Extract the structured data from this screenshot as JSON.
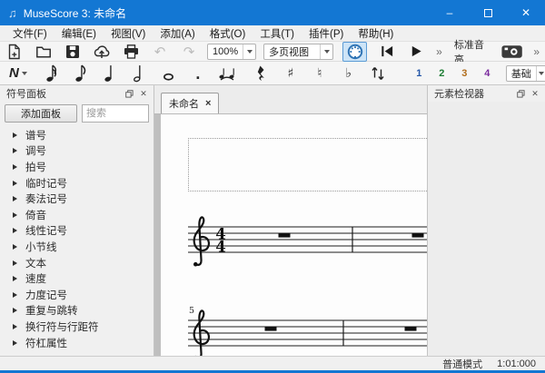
{
  "window": {
    "title": "MuseScore 3: 未命名",
    "controls": {
      "minimize": "–",
      "close": "✕"
    }
  },
  "menu": {
    "items": [
      "文件(F)",
      "编辑(E)",
      "视图(V)",
      "添加(A)",
      "格式(O)",
      "工具(T)",
      "插件(P)",
      "帮助(H)"
    ]
  },
  "toolbar_main": {
    "zoom_value": "100%",
    "view_mode": "多页视图",
    "overflow_left": "»",
    "concert_pitch_label": "标准音高",
    "overflow_right": "»"
  },
  "toolbar_note_input": {
    "note_input_label": "N",
    "sharp": "♯",
    "natural": "♮",
    "flat": "♭",
    "dot": ".",
    "voices": [
      "1",
      "2",
      "3",
      "4"
    ],
    "workspace_value": "基础",
    "add_workspace_label": "+"
  },
  "palette_panel": {
    "title": "符号面板",
    "add_button": "添加面板",
    "search_placeholder": "搜索",
    "items": [
      "谱号",
      "调号",
      "拍号",
      "临时记号",
      "奏法记号",
      "倚音",
      "线性记号",
      "小节线",
      "文本",
      "速度",
      "力度记号",
      "重复与跳转",
      "换行符与行距符",
      "符杠属性"
    ]
  },
  "score_view": {
    "tab": {
      "label": "未命名",
      "close": "×"
    },
    "time_signature": {
      "top": "4",
      "bottom": "4"
    },
    "measure_number": "5"
  },
  "inspector_panel": {
    "title": "元素检视器"
  },
  "status_bar": {
    "mode": "普通模式",
    "position": "1:01:000"
  },
  "colors": {
    "titlebar_blue": "#1377d3",
    "midi_button_active_bg": "#cde4f7",
    "midi_button_active_border": "#5b9bd5",
    "voice_colors": [
      "#2456a8",
      "#1c7d34",
      "#b06c1a",
      "#7a2a9e"
    ]
  },
  "icons": {
    "titlebar": "musescore-logo",
    "toolbar_main": [
      "new-score",
      "open-file",
      "save",
      "cloud-upload",
      "print",
      "undo",
      "redo",
      "midi-connector",
      "rewind",
      "play",
      "screenshot-camera"
    ],
    "toolbar_note_input": [
      "note-input-n",
      "sixteenth-note",
      "eighth-note",
      "quarter-note",
      "half-note",
      "whole-note",
      "augmentation-dot",
      "tie",
      "rest",
      "sharp",
      "natural",
      "flat",
      "flip-direction"
    ]
  }
}
